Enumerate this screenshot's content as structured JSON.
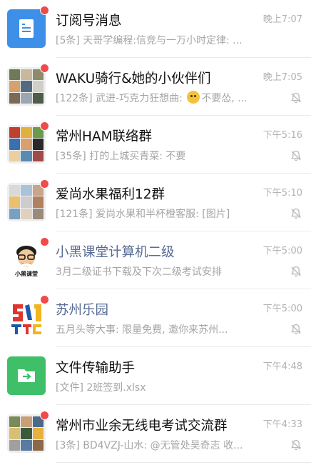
{
  "chats": [
    {
      "name": "订阅号消息",
      "preview": "[5条] 天哥学编程:信竞与一万小时定律: ...",
      "time": "晚上7:07",
      "muted": false,
      "name_blue": false
    },
    {
      "name": "WAKU骑行&她的小伙伴们",
      "preview_before": "[122条] 武进-巧克力狂想曲: ",
      "preview_after": "不要怂, ...",
      "time": "晚上7:05",
      "muted": true,
      "name_blue": false
    },
    {
      "name": "常州HAM联络群",
      "preview": "[35条] 打的上城买青菜: 不要",
      "time": "下午5:16",
      "muted": true,
      "name_blue": false
    },
    {
      "name": "爱尚水果福利12群",
      "preview": "[121条] 爱尚水果和半杯橙客服: [图片]",
      "time": "下午5:10",
      "muted": true,
      "name_blue": false
    },
    {
      "name": "小黑课堂计算机二级",
      "preview": "3月二级证书下载及下次二级考试安排",
      "time": "下午5:00",
      "muted": true,
      "name_blue": true,
      "avatar_text": "小黑课堂"
    },
    {
      "name": "苏州乐园",
      "preview": "五月头等大事: 限量免费, 邀你来苏州...",
      "time": "下午5:00",
      "muted": true,
      "name_blue": true
    },
    {
      "name": "文件传输助手",
      "preview": "[文件] 2班签到.xlsx",
      "time": "下午4:48",
      "muted": false,
      "name_blue": false
    },
    {
      "name": "常州市业余无线电考试交流群",
      "preview": "[3条] BD4VZJ-山水: @无管处吴奇志 收...",
      "time": "下午4:33",
      "muted": true,
      "name_blue": false
    }
  ],
  "colors": {
    "badge": "#f04a4a",
    "subscription": "#3d8fe8",
    "file_helper": "#3fbf68",
    "group_name_blue": "#576b95"
  },
  "icons": {
    "mute": "bell-off-icon",
    "subscription": "document-icon",
    "file_helper": "folder-arrow-icon"
  }
}
